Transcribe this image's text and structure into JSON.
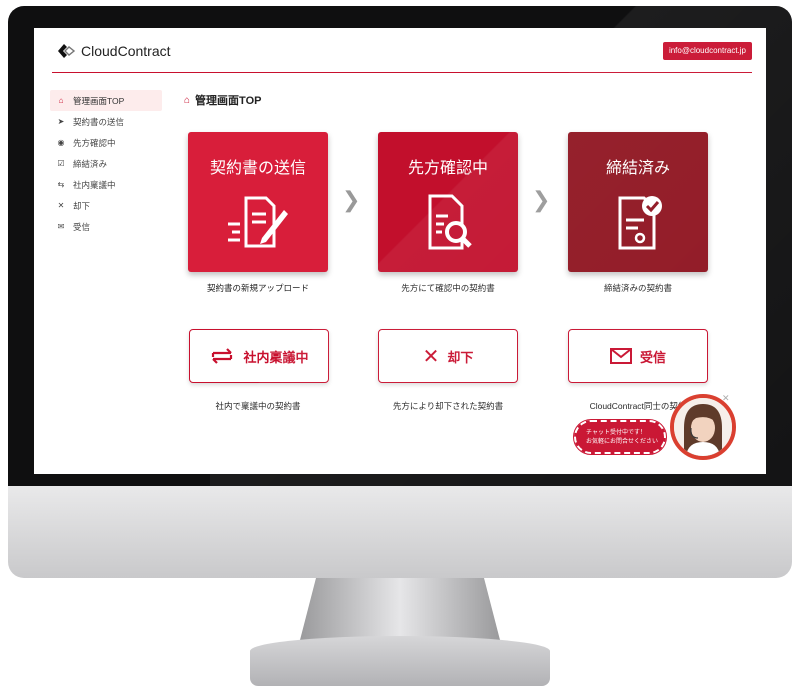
{
  "header": {
    "logo_text": "CloudContract",
    "email": "info@cloudcontract.jp"
  },
  "sidebar": {
    "items": [
      {
        "label": "管理画面TOP",
        "icon": "home-icon",
        "active": true
      },
      {
        "label": "契約書の送信",
        "icon": "send-icon"
      },
      {
        "label": "先方確認中",
        "icon": "eye-icon"
      },
      {
        "label": "締結済み",
        "icon": "check-icon"
      },
      {
        "label": "社内稟議中",
        "icon": "swap-icon"
      },
      {
        "label": "却下",
        "icon": "close-icon"
      },
      {
        "label": "受信",
        "icon": "mail-icon"
      }
    ]
  },
  "main": {
    "title": "管理画面TOP",
    "tiles": [
      {
        "title": "契約書の送信",
        "caption": "契約書の新規アップロード",
        "color": "#d81e3a"
      },
      {
        "title": "先方確認中",
        "caption": "先方にて確認中の契約書",
        "color": "#c20f2c"
      },
      {
        "title": "締結済み",
        "caption": "締結済みの契約書",
        "color": "#8f1420"
      }
    ],
    "buttons": [
      {
        "label": "社内稟議中",
        "caption": "社内で稟議中の契約書",
        "icon": "swap-icon"
      },
      {
        "label": "却下",
        "caption": "先方により却下された契約書",
        "icon": "close-icon"
      },
      {
        "label": "受信",
        "caption": "CloudContract同士の契約",
        "icon": "mail-icon"
      }
    ]
  },
  "chat": {
    "line1": "チャット受付中です！",
    "line2": "お気軽にお問合せください"
  },
  "colors": {
    "accent": "#c8102e"
  }
}
